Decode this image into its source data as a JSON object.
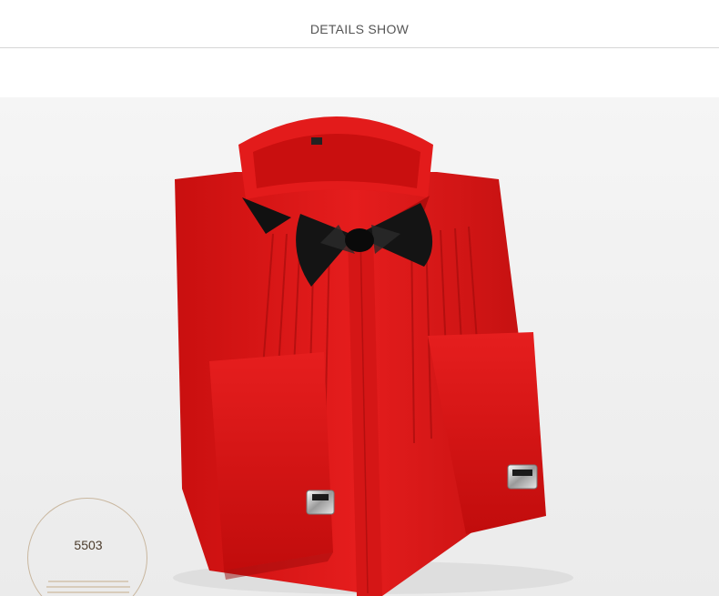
{
  "header": {
    "title": "DETAILS SHOW"
  },
  "badge": {
    "code": "5503"
  },
  "image": {
    "subject": "red-wing-collar-tuxedo-shirt",
    "accessories": [
      "black-bow-tie",
      "silver-cufflinks"
    ],
    "colors": {
      "shirt": "#e01818",
      "bow_tie": "#111111",
      "cufflink": "#b8b8b8"
    }
  }
}
